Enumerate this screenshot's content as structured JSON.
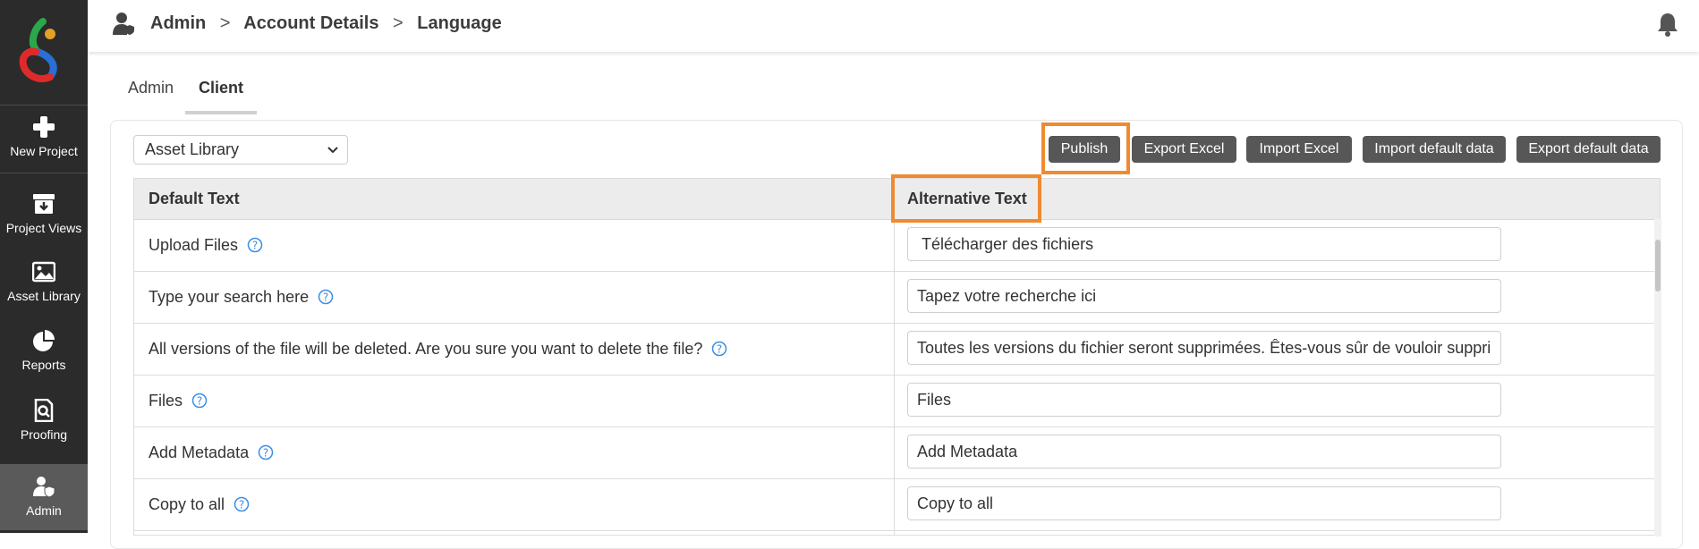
{
  "sidebar": {
    "items": [
      {
        "label": "New Project",
        "icon": "plus-icon"
      },
      {
        "label": "Project Views",
        "icon": "archive-download-icon"
      },
      {
        "label": "Asset Library",
        "icon": "image-icon"
      },
      {
        "label": "Reports",
        "icon": "pie-chart-icon"
      },
      {
        "label": "Proofing",
        "icon": "document-search-icon"
      },
      {
        "label": "Admin",
        "icon": "admin-user-shield-icon"
      }
    ],
    "active": "Admin",
    "bg_color": "#2b2b2b"
  },
  "header": {
    "breadcrumb": [
      "Admin",
      "Account Details",
      "Language"
    ],
    "separator": ">"
  },
  "tabs": [
    {
      "label": "Admin",
      "active": false
    },
    {
      "label": "Client",
      "active": true
    }
  ],
  "toolbar": {
    "select_value": "Asset Library",
    "buttons": [
      "Publish",
      "Export Excel",
      "Import Excel",
      "Import default data",
      "Export default data"
    ],
    "button_color": "#575757",
    "highlight_color": "#f08a30"
  },
  "table": {
    "headers": {
      "default": "Default Text",
      "alternative": "Alternative Text"
    },
    "rows": [
      {
        "default": "Upload Files",
        "alternative": "Télécharger des fichiers"
      },
      {
        "default": "Type your search here",
        "alternative": "Tapez votre recherche ici"
      },
      {
        "default": "All versions of the file will be deleted. Are you sure you want to delete the file?",
        "alternative": "Toutes les versions du fichier seront supprimées. Êtes-vous sûr de vouloir supprime"
      },
      {
        "default": "Files",
        "alternative": "Files"
      },
      {
        "default": "Add Metadata",
        "alternative": "Add Metadata"
      },
      {
        "default": "Copy to all",
        "alternative": "Copy to all"
      }
    ]
  }
}
